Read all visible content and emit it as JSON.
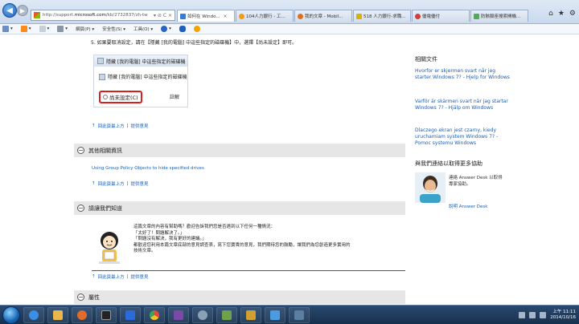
{
  "browser": {
    "url_prefix": "http://support.",
    "url_domain": "microsoft.com",
    "url_rest": "/kb/2732837/zh-tw",
    "addr_controls": "▾ ⊘ C ×",
    "back_glyph": "◀",
    "forward_glyph": "▶",
    "tabs": [
      {
        "label": "如何在 Windo...",
        "active": true,
        "color": "#3a7bd5"
      },
      {
        "label": "104人力銀行 - 工...",
        "active": false,
        "color": "#f29b1b"
      },
      {
        "label": "我的文章 - Mobil...",
        "active": false,
        "color": "#e26d1d"
      },
      {
        "label": "518 人力銀行-求職...",
        "active": false,
        "color": "#d9b300"
      },
      {
        "label": "優電優付",
        "active": false,
        "color": "#d23c3c"
      },
      {
        "label": "防駭腳座搜索開機...",
        "active": false,
        "color": "#4caf50"
      }
    ],
    "tab_close": "×",
    "window_controls": [
      "⌂",
      "★",
      "⚙"
    ]
  },
  "commandbar": {
    "items": [
      {
        "name": "home-menu",
        "label": "▾"
      },
      {
        "name": "feeds-menu",
        "label": "▾"
      },
      {
        "name": "mail-menu",
        "label": "▾"
      },
      {
        "name": "print-menu",
        "label": "▾"
      },
      {
        "name": "page-menu",
        "label": "網頁(P) ▾"
      },
      {
        "name": "safety-menu",
        "label": "安全性(S) ▾"
      },
      {
        "name": "tools-menu",
        "label": "工具(O) ▾"
      },
      {
        "name": "help-menu",
        "label": "▾"
      }
    ]
  },
  "content": {
    "step5": "5. 如果要取消設定，請在【隱藏 [我的電腦] 中這些指定的磁碟機】中，選擇【尚未設定】即可。",
    "shot_title": "隱藏 [我的電腦] 中這些指定的磁碟機",
    "shot_row": "隱藏 [我的電腦] 中這些指定的磁碟機",
    "shot_radio": "尚未設定(C)",
    "shot_note": "註解",
    "back_to_top": "回此頁最上方",
    "separator": "|",
    "feedback": "提供意見",
    "section_related": "其他相關資訊",
    "related_link": "Using Group Policy Objects to hide specified drives",
    "section_tell": "請讓我們知道",
    "feedback_lines": [
      "這篇文章的內容有幫助嗎？歡迎告訴我們您是否遇到以下任何一種情況：",
      "「太好了！問題解決了。」",
      "「問題沒有解決，我有更好的建議。」",
      "都歡迎您利用本篇文章底部的意見調查表，寫下您寶貴的意見，我們期待您的鼓勵，讓我們為您創造更多實用的",
      "技術文章。"
    ],
    "section_props": "屬性"
  },
  "sidebar": {
    "related_title": "相關文件",
    "links": [
      "Hvorfor er skjermen svart når jeg starter Windows 7? - Hjelp for Windows",
      "Varför är skärmen svart när jag startar Windows 7? - Hjälp om Windows",
      "Dlaczego ekran jest czarny, kiedy uruchamiam system Windows 7? - Pomoc systemu Windows"
    ],
    "help_title": "與我們連絡以取得更多協助",
    "agent_text": "連絡 Answer Desk 以取得專家協助。",
    "agent_link": "說明 Answer Desk"
  },
  "taskbar": {
    "apps": [
      {
        "name": "ie-taskbar-button",
        "color": "#3a8ee6"
      },
      {
        "name": "explorer-taskbar-button",
        "color": "#e8b84a"
      },
      {
        "name": "media-player-taskbar-button",
        "color": "#e06b2d"
      },
      {
        "name": "cmd-taskbar-button",
        "color": "#222222"
      },
      {
        "name": "word-taskbar-button",
        "color": "#2b6ad9"
      },
      {
        "name": "chrome-taskbar-button",
        "color": "#e04a3c"
      },
      {
        "name": "photo-taskbar-button",
        "color": "#7b4aa8"
      },
      {
        "name": "settings-taskbar-button",
        "color": "#8aa0b5"
      },
      {
        "name": "tool-taskbar-button",
        "color": "#6fa04c"
      },
      {
        "name": "app2-taskbar-button",
        "color": "#d0a030"
      },
      {
        "name": "network-taskbar-button",
        "color": "#4a9be0"
      },
      {
        "name": "screen-taskbar-button",
        "color": "#5b7fa3"
      }
    ],
    "time": "上午 11:11",
    "date": "2014/10/16"
  }
}
